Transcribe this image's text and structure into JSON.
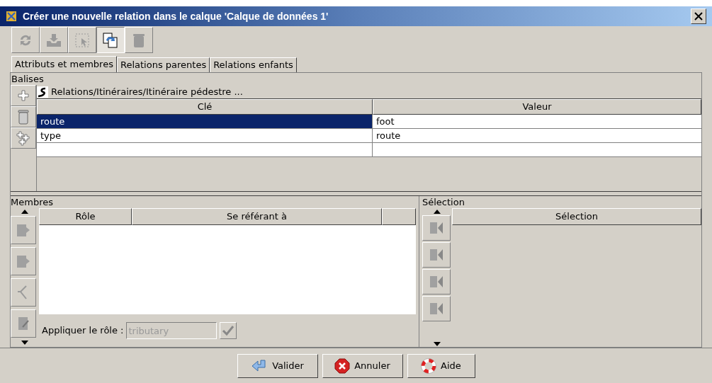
{
  "window": {
    "title": "Créer une nouvelle relation dans le calque 'Calque de données 1'"
  },
  "toolbar": [
    {
      "kind": "refresh",
      "disabled": true
    },
    {
      "kind": "download",
      "disabled": true
    },
    {
      "kind": "select",
      "disabled": true
    },
    {
      "kind": "copy",
      "disabled": false
    },
    {
      "kind": "delete",
      "disabled": true
    }
  ],
  "tabs": [
    {
      "label": "Attributs et membres",
      "selected": true
    },
    {
      "label": "Relations parentes",
      "selected": false
    },
    {
      "label": "Relations enfants",
      "selected": false
    }
  ],
  "tags": {
    "title": "Balises",
    "preset": "Relations/Itinéraires/Itinéraire pédestre ...",
    "columns": [
      "Clé",
      "Valeur"
    ],
    "rows": [
      {
        "key": "route",
        "value": "foot",
        "selected": true
      },
      {
        "key": "type",
        "value": "route",
        "selected": false
      }
    ]
  },
  "members": {
    "title": "Membres",
    "columns": [
      "Rôle",
      "Se référant à"
    ],
    "apply_role_label": "Appliquer le rôle :",
    "role_value": "tributary"
  },
  "selection": {
    "title": "Sélection",
    "columns": [
      "Sélection"
    ]
  },
  "buttons": [
    {
      "kind": "ok",
      "label": "Valider"
    },
    {
      "kind": "cancel",
      "label": "Annuler"
    },
    {
      "kind": "help",
      "label": "Aide"
    }
  ]
}
